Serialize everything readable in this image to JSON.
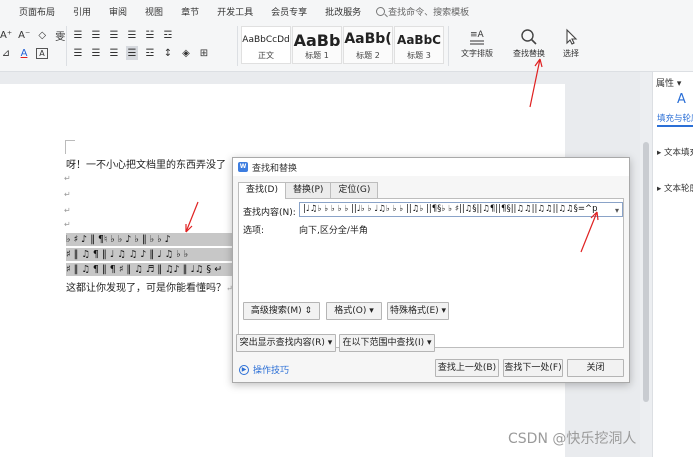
{
  "menubar": {
    "items": [
      "页面布局",
      "引用",
      "审阅",
      "视图",
      "章节",
      "开发工具",
      "会员专享",
      "批改服务"
    ],
    "search_placeholder": "查找命令、搜索模板"
  },
  "ribbon": {
    "row1": [
      "A⁺",
      "A⁻",
      "◇",
      "雯",
      "☰",
      "☰",
      "☰",
      "☰",
      "☱",
      "☲",
      "A",
      "☷"
    ],
    "row2": [
      "⊿",
      "A",
      "A",
      "☰",
      "☰",
      "☰",
      "☰",
      "☲",
      "↕",
      "◈",
      "⊞"
    ],
    "styles": [
      {
        "sample": "AaBbCcDd",
        "name": "正文"
      },
      {
        "sample": "AaBb",
        "name": "标题 1"
      },
      {
        "sample": "AaBb(",
        "name": "标题 2"
      },
      {
        "sample": "AaBbC",
        "name": "标题 3"
      }
    ],
    "text_layout_label": "文字排版",
    "find_replace_label": "查找替换",
    "select_label": "选择"
  },
  "document": {
    "line1": "呀！一不小心把文档里的东西弄没了",
    "para_mark": "↵",
    "hl_lines": [
      "♭ ♯ ♪ ‖ ¶♮ ♭ ♭ ♪ ♭ ‖ ♭ ♭ ♪",
      "♯ ‖ ♫ ¶ ‖ ♩ ♫ ♫ ♪ ‖ ♩ ♫ ♭ ♭",
      "♯ ‖ ♫ ¶ ‖ ¶ ♯ ‖ ♫ ♬ ‖ ♫♪ ‖ ♩♫ § ↵"
    ],
    "last_line": "这都让你发现了，可是你能看懂吗？",
    "last_line_tail": "↵"
  },
  "right_panel": {
    "title": "属性",
    "tab_label": "填充与轮廓",
    "items": [
      "文本填充",
      "文本轮廓"
    ]
  },
  "dialog": {
    "title": "查找和替换",
    "tabs": [
      "查找(D)",
      "替换(P)",
      "定位(G)"
    ],
    "find_label": "查找内容(N):",
    "find_value": "|♩♫♭ ♭ ♭ ♭ ♭ ||♩♭ ♭ ♩♫♭ ♭ ♭ ||♫♭ ||¶§♭ ♭ ♯||♫§||♫¶||¶§||♫♫||♫♫||♫♫§=^p",
    "options_label": "选项:",
    "options_value": "向下,区分全/半角",
    "btn_advanced": "高级搜索(M)",
    "btn_format": "格式(O)",
    "btn_special": "特殊格式(E)",
    "btn_highlight": "突出显示查找内容(R)",
    "btn_range": "在以下范围中查找(I)",
    "link_tips": "操作技巧",
    "btn_find_prev": "查找上一处(B)",
    "btn_find_next": "查找下一处(F)",
    "btn_close": "关闭"
  },
  "watermark": "CSDN @快乐挖洞人",
  "colors": {
    "accent": "#2b6fd6",
    "annotation": "#e02020"
  }
}
